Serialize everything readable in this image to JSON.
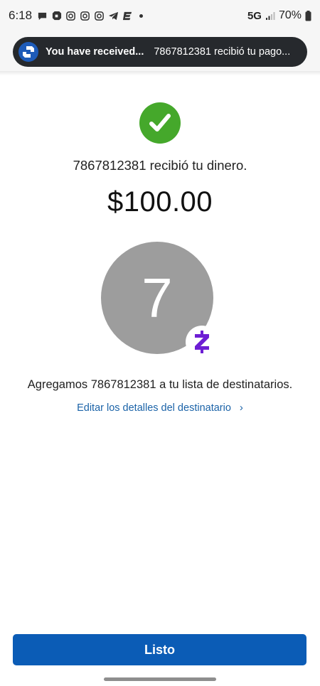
{
  "status_bar": {
    "time": "6:18",
    "network": "5G",
    "battery": "70%",
    "notification_icons": [
      "chat-bubble-icon",
      "chase-icon",
      "instagram-icon",
      "instagram-icon",
      "instagram-icon",
      "telegram-icon",
      "app-e-icon",
      "dot-icon"
    ]
  },
  "notification": {
    "title": "You have received...",
    "body": "7867812381 recibió tu pago...",
    "app_icon": "chase-logo-icon"
  },
  "confirmation": {
    "message": "7867812381 recibió tu dinero.",
    "amount": "$100.00"
  },
  "recipient": {
    "initial": "7",
    "badge_icon": "zelle-icon",
    "added_message": "Agregamos 7867812381 a tu lista de destinatarios.",
    "edit_link": "Editar los detalles del destinatario",
    "edit_chevron": "›"
  },
  "actions": {
    "done_label": "Listo"
  },
  "colors": {
    "success_green": "#45a82b",
    "primary_blue": "#0b5cb6",
    "link_blue": "#1b63a8",
    "zelle_purple": "#6d1ed4",
    "avatar_gray": "#9d9d9d"
  }
}
